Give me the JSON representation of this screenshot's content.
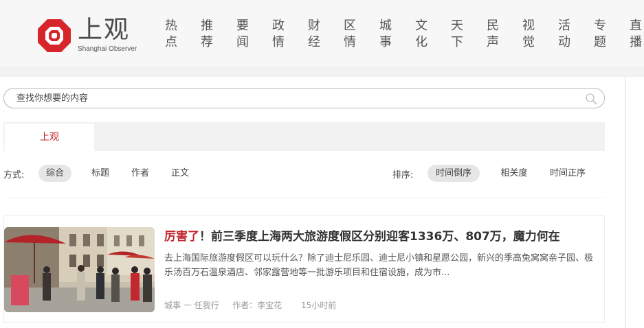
{
  "logo": {
    "name_cn": "上观",
    "name_en": "Shanghai Observer",
    "brand_color": "#d7262b"
  },
  "nav": [
    {
      "label": "热\n点"
    },
    {
      "label": "推\n荐"
    },
    {
      "label": "要\n闻"
    },
    {
      "label": "政\n情"
    },
    {
      "label": "财\n经"
    },
    {
      "label": "区\n情"
    },
    {
      "label": "城\n事"
    },
    {
      "label": "文\n化"
    },
    {
      "label": "天\n下"
    },
    {
      "label": "民\n声"
    },
    {
      "label": "视\n觉"
    },
    {
      "label": "活\n动"
    },
    {
      "label": "专\n题"
    },
    {
      "label": "直\n播"
    }
  ],
  "search": {
    "placeholder": "查找你想要的内容",
    "icon": "search-icon"
  },
  "tabs": [
    {
      "label": "上观",
      "active": true
    }
  ],
  "filters": {
    "mode_label": "方式:",
    "modes": [
      "综合",
      "标题",
      "作者",
      "正文"
    ],
    "active_mode": "综合",
    "sort_label": "排序:",
    "sorts": [
      "时间倒序",
      "相关度",
      "时间正序"
    ],
    "active_sort": "时间倒序"
  },
  "article": {
    "title_highlight": "厉害了",
    "title_rest": "！前三季度上海两大旅游度假区分别迎客1336万、807万，魔力何在",
    "summary": "去上海国际旅游度假区可以玩什么？除了迪士尼乐园、迪士尼小镇和星愿公园，新兴的季高兔窝窝亲子园、极乐汤百万石温泉酒店、邻家露营地等一批游乐项目和住宿设施，成为市...",
    "channel": "城事 一 任我行",
    "author": "作者：李宝花",
    "time": "15小时前"
  }
}
